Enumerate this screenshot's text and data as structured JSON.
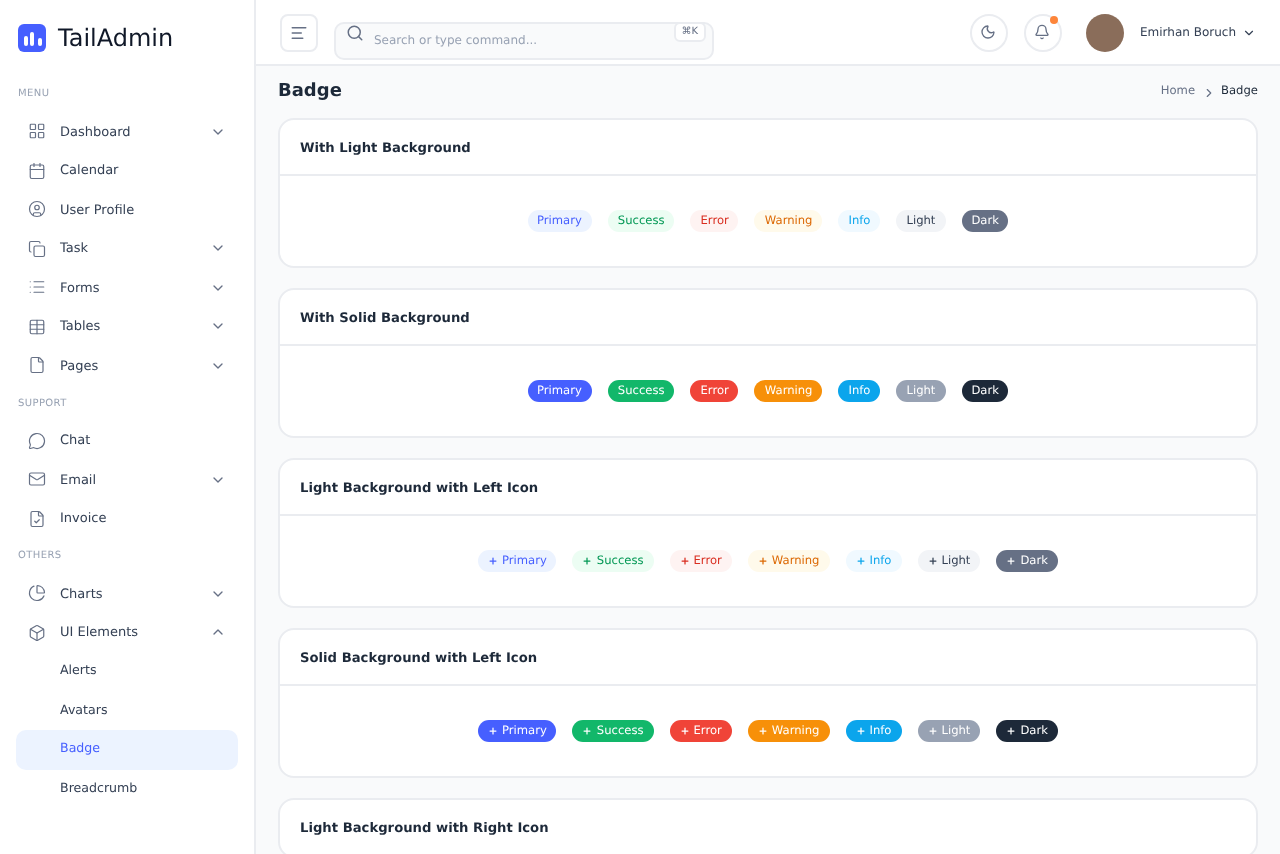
{
  "brand": {
    "name": "TailAdmin"
  },
  "sidebar": {
    "sections": [
      {
        "title": "MENU",
        "items": [
          {
            "label": "Dashboard",
            "expanded": false,
            "selected": false
          },
          {
            "label": "Calendar",
            "selected": false
          },
          {
            "label": "User Profile",
            "selected": false
          },
          {
            "label": "Task",
            "expanded": false,
            "selected": false
          },
          {
            "label": "Forms",
            "expanded": false,
            "selected": false
          },
          {
            "label": "Tables",
            "expanded": false,
            "selected": false
          },
          {
            "label": "Pages",
            "expanded": false,
            "selected": false
          }
        ]
      },
      {
        "title": "SUPPORT",
        "items": [
          {
            "label": "Chat",
            "selected": false
          },
          {
            "label": "Email",
            "expanded": false,
            "selected": false
          },
          {
            "label": "Invoice",
            "selected": false
          }
        ]
      },
      {
        "title": "OTHERS",
        "items": [
          {
            "label": "Charts",
            "expanded": false,
            "selected": false
          },
          {
            "label": "UI Elements",
            "expanded": true,
            "selected": false,
            "children": [
              {
                "label": "Alerts",
                "selected": false
              },
              {
                "label": "Avatars",
                "selected": false
              },
              {
                "label": "Badge",
                "selected": true
              },
              {
                "label": "Breadcrumb",
                "selected": false
              }
            ]
          }
        ]
      }
    ]
  },
  "header": {
    "search": {
      "placeholder": "Search or type command...",
      "shortcut": "⌘K"
    },
    "notifications": {
      "unread": true
    },
    "user": {
      "name": "Emirhan Boruch"
    }
  },
  "page": {
    "title": "Badge",
    "breadcrumb": [
      {
        "label": "Home",
        "current": false
      },
      {
        "label": "Badge",
        "current": true
      }
    ]
  },
  "cards": [
    {
      "title": "With Light Background",
      "kind": "light",
      "badges": [
        {
          "label": "Primary",
          "kind": "primary"
        },
        {
          "label": "Success",
          "kind": "success"
        },
        {
          "label": "Error",
          "kind": "error"
        },
        {
          "label": "Warning",
          "kind": "warning"
        },
        {
          "label": "Info",
          "kind": "info"
        },
        {
          "label": "Light",
          "kind": "light"
        },
        {
          "label": "Dark",
          "kind": "dark"
        }
      ]
    },
    {
      "title": "With Solid Background",
      "kind": "solid",
      "badges": [
        {
          "label": "Primary",
          "kind": "primary"
        },
        {
          "label": "Success",
          "kind": "success"
        },
        {
          "label": "Error",
          "kind": "error"
        },
        {
          "label": "Warning",
          "kind": "warning"
        },
        {
          "label": "Info",
          "kind": "info"
        },
        {
          "label": "Light",
          "kind": "light"
        },
        {
          "label": "Dark",
          "kind": "dark"
        }
      ]
    },
    {
      "title": "Light Background with Left Icon",
      "kind": "light-left-icon",
      "badges": [
        {
          "label": "Primary",
          "kind": "primary"
        },
        {
          "label": "Success",
          "kind": "success"
        },
        {
          "label": "Error",
          "kind": "error"
        },
        {
          "label": "Warning",
          "kind": "warning"
        },
        {
          "label": "Info",
          "kind": "info"
        },
        {
          "label": "Light",
          "kind": "light"
        },
        {
          "label": "Dark",
          "kind": "dark"
        }
      ]
    },
    {
      "title": "Solid Background with Left Icon",
      "kind": "solid-left-icon",
      "badges": [
        {
          "label": "Primary",
          "kind": "primary"
        },
        {
          "label": "Success",
          "kind": "success"
        },
        {
          "label": "Error",
          "kind": "error"
        },
        {
          "label": "Warning",
          "kind": "warning"
        },
        {
          "label": "Info",
          "kind": "info"
        },
        {
          "label": "Light",
          "kind": "light"
        },
        {
          "label": "Dark",
          "kind": "dark"
        }
      ]
    },
    {
      "title": "Light Background with Right Icon"
    }
  ]
}
